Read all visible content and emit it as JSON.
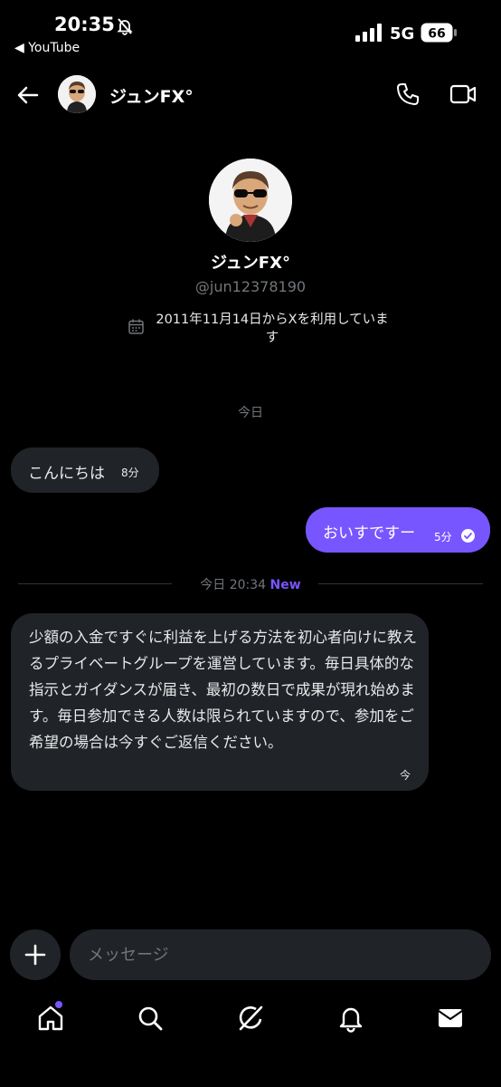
{
  "status_bar": {
    "time": "20:35",
    "back_app": "◀ YouTube",
    "network": "5G",
    "battery": "66"
  },
  "header": {
    "name": "ジュンFX°"
  },
  "profile": {
    "name": "ジュンFX°",
    "handle": "@jun12378190",
    "joined": "2011年11月14日からXを利用しています"
  },
  "conversation": {
    "day_separator": "今日",
    "messages": [
      {
        "direction": "incoming",
        "text": "こんにちは",
        "time": "8分"
      },
      {
        "direction": "outgoing",
        "text": "おいすですー",
        "time": "5分"
      }
    ],
    "new_separator": {
      "label": "今日 20:34",
      "badge": "New"
    },
    "latest": {
      "direction": "incoming",
      "text": "少額の入金ですぐに利益を上げる方法を初心者向けに教えるプライベートグループを運営しています。毎日具体的な指示とガイダンスが届き、最初の数日で成果が現れ始めます。毎日参加できる人数は限られていますので、参加をご希望の場合は今すぐご返信ください。",
      "time": "今"
    }
  },
  "composer": {
    "placeholder": "メッセージ"
  },
  "nav": {
    "items": [
      "home-icon",
      "search-icon",
      "grok-icon",
      "notifications-icon",
      "messages-icon"
    ]
  },
  "colors": {
    "accent": "#7856ff",
    "bubble_in": "#202327",
    "muted": "#71767b"
  }
}
